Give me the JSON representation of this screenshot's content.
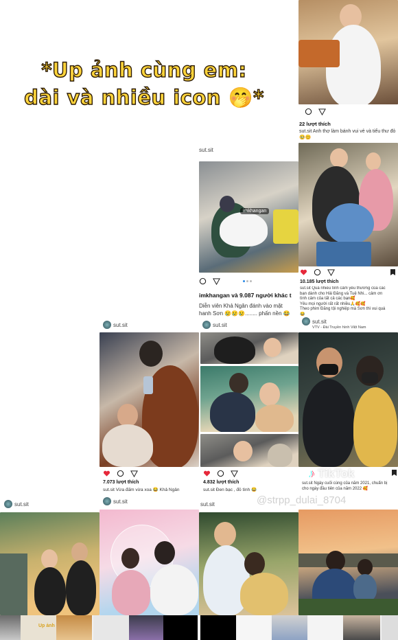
{
  "title_lines": [
    "*Up ảnh cùng em:",
    "dài và nhiều icon 🤭*"
  ],
  "handle": "sut.sit",
  "post_top_right": {
    "likes": "22 lượt thích",
    "caption": "sut.sit Anh thợ làm bánh vui vẻ và tiểu thư đỏ",
    "emoji": "🥹😊"
  },
  "post_mid_left": {
    "handle": "sut.sit",
    "photo_tag": "imkhangan",
    "liked_by": "imkhangan và 9.087 người khác t",
    "caption_1": "Diễn viên Khả Ngân đánh vào mặt",
    "caption_2": "hanh Sơn 😢😢😢........ phấn nền 😂"
  },
  "post_mid_right": {
    "likes": "10.185 lượt thích",
    "caption_1": "sut.sit Quá nhiều tình cảm yêu thương của các",
    "caption_2": "bạn dành cho Hải Đăng và Tuệ Nhi... cảm ơn",
    "caption_3": "tình cảm của tất cả các bạn🥰",
    "caption_4": "Yêu mọi người rất rất nhiều🙏🥰🥰",
    "caption_5": "Theo phim Đăng tội nghiệp mà Sơn thì vui quá",
    "caption_6": "😂"
  },
  "post_row2_a": {
    "handle": "sut.sit",
    "likes": "7.073 lượt thích",
    "caption": "sut.sit Vừa đấm vừa xoa 😂 Khả Ngân"
  },
  "post_row2_b": {
    "handle": "sut.sit",
    "likes": "4.832 lượt thích",
    "caption": "sut.sit Đen bạc , đỏ tình 😂"
  },
  "post_row2_c": {
    "handle": "sut.sit",
    "subhandle": "VTV - Đài Truyền hình Việt Nam",
    "caption_1": "sut.sit Ngày cuối cùng của năm 2021, chuẩn bị",
    "caption_2": "cho ngày đầu tiên của năm 2022 🥰"
  },
  "watermark": "TikTok",
  "watermark_handle": "@strpp_dulai_8704",
  "row3_handles": [
    "sut.sit",
    "sut.sit",
    "sut.sit"
  ],
  "strip_label": "Up ảnh cùng em"
}
